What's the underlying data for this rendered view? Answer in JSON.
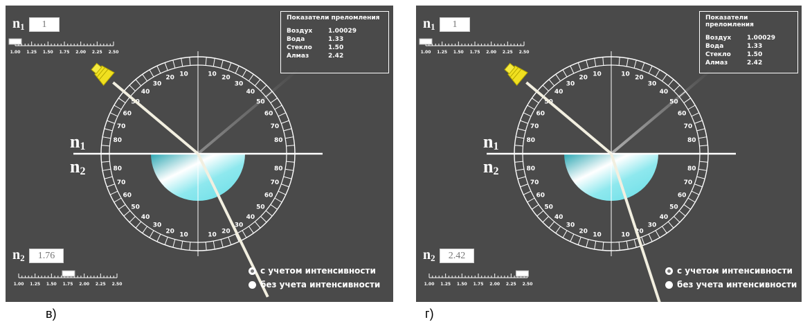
{
  "panels": [
    {
      "caption": "в)",
      "n1_label": "n",
      "n1_sub": "1",
      "n1_value": "1",
      "n2_label": "n",
      "n2_sub": "2",
      "n2_value": "1.76",
      "n1_slider_value": 1.0,
      "n2_slider_value": 1.76,
      "incidence_angle_deg": 50,
      "refraction_angle_deg": 26,
      "reflection_opacity": 0.35,
      "selected_mode": 0
    },
    {
      "caption": "г)",
      "n1_label": "n",
      "n1_sub": "1",
      "n1_value": "1",
      "n2_label": "n",
      "n2_sub": "2",
      "n2_value": "2.42",
      "n1_slider_value": 1.0,
      "n2_slider_value": 2.42,
      "incidence_angle_deg": 50,
      "refraction_angle_deg": 18,
      "reflection_opacity": 0.55,
      "selected_mode": 0
    }
  ],
  "slider_ticks": [
    "1.00",
    "1.25",
    "1.50",
    "1.75",
    "2.00",
    "2.25",
    "2.50"
  ],
  "slider_range": [
    1.0,
    2.5
  ],
  "legend": {
    "title": "Показатели преломления",
    "rows": [
      {
        "name": "Воздух",
        "value": "1.00029"
      },
      {
        "name": "Вода",
        "value": "1.33"
      },
      {
        "name": "Стекло",
        "value": "1.50"
      },
      {
        "name": "Алмаз",
        "value": "2.42"
      }
    ]
  },
  "medium_labels": {
    "top": "n",
    "top_sub": "1",
    "bottom": "n",
    "bottom_sub": "2"
  },
  "protractor_labels": [
    "10",
    "20",
    "30",
    "40",
    "50",
    "60",
    "70",
    "80"
  ],
  "modes": [
    "с учетом интенсивности",
    "без учета интенсивности"
  ],
  "colors": {
    "background": "#4a4a4a",
    "beam": "#f2efe0",
    "medium": "#66dde6",
    "lamp": "#f0e020"
  }
}
